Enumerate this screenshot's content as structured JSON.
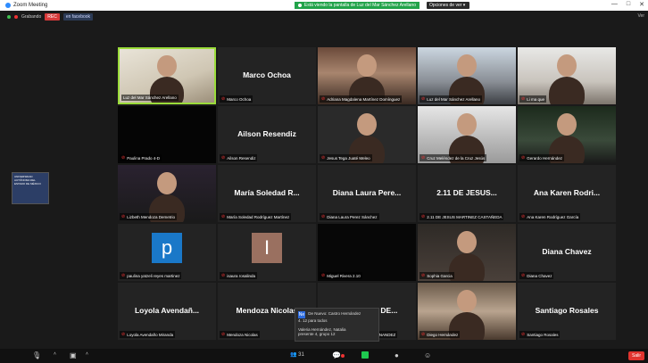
{
  "window": {
    "title": "Zoom Meeting",
    "share_banner": "Está viendo la pantalla de Luz del Mar Sánchez Arellano",
    "view_options": "Opciones de ver",
    "controls": [
      "—",
      "□",
      "✕"
    ]
  },
  "topbar": {
    "rec_label": "REC",
    "hd_label": "en facebook",
    "status_label": "Grabando",
    "view_label": "Ver"
  },
  "side_share": {
    "text": "UNIVERSIDAD AUTÓNOMA DEL ESTADO DE MÉXICO"
  },
  "participants": [
    {
      "name": "",
      "label": "Luz del Mar Sánchez Arellano",
      "video": "v1",
      "muted": false,
      "active": true
    },
    {
      "name": "Marco Ochoa",
      "label": "Marco Ochoa",
      "video": "",
      "muted": true
    },
    {
      "name": "",
      "label": "Adriana Magdalena Martínez Domínguez",
      "video": "v3",
      "muted": true
    },
    {
      "name": "",
      "label": "Luz del Mar Sánchez Arellano",
      "video": "v4",
      "muted": true
    },
    {
      "name": "",
      "label": "Li ma que",
      "video": "v5",
      "muted": true
    },
    {
      "name": "",
      "label": "Paulina Prado 4-D",
      "video": "v6",
      "muted": true
    },
    {
      "name": "Ailson Resendiz",
      "label": "Ailson Resendiz",
      "video": "",
      "muted": true
    },
    {
      "name": "",
      "label": "Jesus Tega Juaté Meleo",
      "video": "v8",
      "muted": true
    },
    {
      "name": "",
      "label": "Cruz Meléndez de la Cruz Jesús",
      "video": "v9",
      "muted": true
    },
    {
      "name": "",
      "label": "Gerardo Hernández",
      "video": "v10",
      "muted": true
    },
    {
      "name": "",
      "label": "Lizbeth Mendoza Demetrio",
      "video": "v11",
      "muted": true
    },
    {
      "name": "María Soledad R...",
      "label": "María Soledad Rodríguez Martínez",
      "video": "",
      "muted": true
    },
    {
      "name": "Diana Laura Pere...",
      "label": "Diana Laura Perez Sánchez",
      "video": "",
      "muted": true
    },
    {
      "name": "2.11 DE JESUS...",
      "label": "2.11 DE JESUS MARTINEZ CASTAÑEDA",
      "video": "",
      "muted": true
    },
    {
      "name": "Ana Karen Rodri...",
      "label": "Ana Karen Rodríguez García",
      "video": "",
      "muted": true
    },
    {
      "name": "",
      "label": "paulina yatzeli reyes martinez",
      "video": "",
      "avatar": "p",
      "avatar_color": "#1a78c8",
      "muted": true
    },
    {
      "name": "",
      "label": "isaura rosalinda",
      "video": "",
      "avatar": "I",
      "avatar_color": "#9a7060",
      "muted": true
    },
    {
      "name": "",
      "label": "Miguel Rivera 2.10",
      "video": "v18",
      "muted": true
    },
    {
      "name": "",
      "label": "Sophia Garcia",
      "video": "v19",
      "muted": true
    },
    {
      "name": "Diana Chavez",
      "label": "Diana Chavez",
      "video": "",
      "muted": true
    },
    {
      "name": "Loyola Avendañ...",
      "label": "Loyola Avendaño Miranda",
      "video": "",
      "muted": true
    },
    {
      "name": "Mendoza Nicolas",
      "label": "Mendoza Nicolas",
      "video": "",
      "muted": true
    },
    {
      "name": "FERNANDA DE...",
      "label": "FERNANDA DE JESUS HERNANDEZ",
      "video": "",
      "muted": true
    },
    {
      "name": "",
      "label": "Diego Hernández",
      "video": "v23",
      "muted": true
    },
    {
      "name": "Santiago Rosales",
      "label": "Santiago Rosales",
      "video": "",
      "muted": true
    }
  ],
  "toast": {
    "icon": "Ne",
    "line1": "De Nuevo: Castro Hernández",
    "line2": "4. 12 para todos",
    "line3": "Valeria Hernández, Natalia",
    "line4": "presente 4, grupo 12"
  },
  "bottombar": {
    "participants_count": "31",
    "end_label": "Salir"
  }
}
